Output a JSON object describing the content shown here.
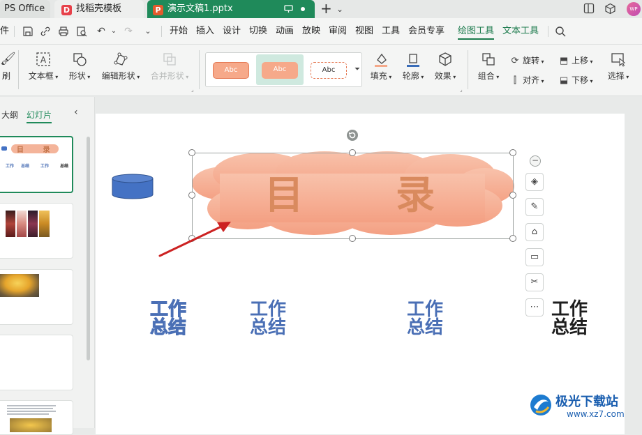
{
  "titlebar": {
    "tabs": [
      {
        "label": "PS Office"
      },
      {
        "label": "找稻壳模板",
        "badge": "D"
      },
      {
        "label": "演示文稿1.pptx",
        "badge": "P"
      }
    ],
    "new_tab": "+",
    "avatar": "WP"
  },
  "menubar": {
    "file_fragment": "件",
    "items": [
      "开始",
      "插入",
      "设计",
      "切换",
      "动画",
      "放映",
      "审阅",
      "视图",
      "工具",
      "会员专享",
      "绘图工具",
      "文本工具"
    ],
    "active": "绘图工具"
  },
  "ribbon": {
    "brush_label": "刷",
    "textbox": "文本框",
    "shape": "形状",
    "edit_shape": "编辑形状",
    "merge_shape": "合并形状",
    "style_samples": [
      "Abc",
      "Abc",
      "Abc"
    ],
    "fill": "填充",
    "outline": "轮廓",
    "effect": "效果",
    "group": "组合",
    "rotate": "旋转",
    "align": "对齐",
    "bring_forward": "上移",
    "send_backward": "下移",
    "select": "选择"
  },
  "leftpanel": {
    "tab_outline": "大纲",
    "tab_slides": "幻灯片",
    "thumb1_title": "目 录",
    "thumb1_items": [
      "工作",
      "总结",
      "工作",
      "总结"
    ]
  },
  "slide": {
    "title_left": "目",
    "title_right": "录",
    "wordart": [
      {
        "line1": "工作",
        "line2": "总结"
      },
      {
        "line1": "工作",
        "line2": "总结"
      },
      {
        "line1": "工作",
        "line2": "总结"
      },
      {
        "line1": "工作",
        "line2": "总结"
      }
    ]
  },
  "watermark": {
    "name": "极光下载站",
    "url": "www.xz7.com"
  },
  "colors": {
    "accent": "#1f8a5a",
    "cloud": "#f4a98a",
    "title_text": "#d98a5e",
    "wordart_blue": "#4a6fb5",
    "cylinder": "#4472c4",
    "arrow": "#cc2222"
  }
}
